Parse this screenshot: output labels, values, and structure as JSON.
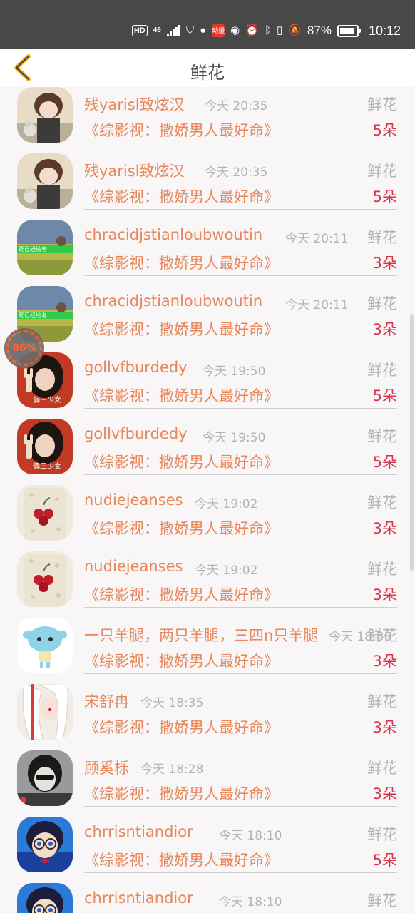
{
  "status_bar": {
    "hd": "HD",
    "network": "46",
    "app_badge": "动漫",
    "battery_percent": "87%",
    "battery_level": 0.87,
    "time": "10:12"
  },
  "header": {
    "title": "鲜花",
    "back_icon": "chevron-left-icon",
    "accent": "#f2b21e"
  },
  "floating_widget": {
    "label": "86%"
  },
  "rows": [
    {
      "name": "残yarisl致炫汉",
      "time": "今天 20:35",
      "gift": "鲜花",
      "book": "《综影视：撒娇男人最好命》",
      "count": "5朵",
      "avatar": "anime-boy-avatar"
    },
    {
      "name": "残yarisl致炫汉",
      "time": "今天 20:35",
      "gift": "鲜花",
      "book": "《综影视：撒娇男人最好命》",
      "count": "5朵",
      "avatar": "anime-boy-avatar"
    },
    {
      "name": "chracidjstianloubwoutin",
      "time": "今天 20:11",
      "gift": "鲜花",
      "book": "《综影视：撒娇男人最好命》",
      "count": "3朵",
      "avatar": "field-avatar"
    },
    {
      "name": "chracidjstianloubwoutin",
      "time": "今天 20:11",
      "gift": "鲜花",
      "book": "《综影视：撒娇男人最好命》",
      "count": "3朵",
      "avatar": "field-avatar"
    },
    {
      "name": "gollvfburdedy",
      "time": "今天 19:50",
      "gift": "鲜花",
      "book": "《综影视：撒娇男人最好命》",
      "count": "5朵",
      "avatar": "girl-peace-avatar"
    },
    {
      "name": "gollvfburdedy",
      "time": "今天 19:50",
      "gift": "鲜花",
      "book": "《综影视：撒娇男人最好命》",
      "count": "5朵",
      "avatar": "girl-peace-avatar"
    },
    {
      "name": "nudiejeanses",
      "time": "今天 19:02",
      "gift": "鲜花",
      "book": "《综影视：撒娇男人最好命》",
      "count": "3朵",
      "avatar": "cherry-phone-avatar"
    },
    {
      "name": "nudiejeanses",
      "time": "今天 19:02",
      "gift": "鲜花",
      "book": "《综影视：撒娇男人最好命》",
      "count": "3朵",
      "avatar": "cherry-phone-avatar"
    },
    {
      "name": "一只羊腿，两只羊腿，三四n只羊腿",
      "time": "今天 18:38",
      "gift": "鲜花",
      "book": "《综影视：撒娇男人最好命》",
      "count": "3朵",
      "avatar": "blue-creature-avatar"
    },
    {
      "name": "宋舒冉",
      "time": "今天 18:35",
      "gift": "鲜花",
      "book": "《综影视：撒娇男人最好命》",
      "count": "3朵",
      "avatar": "white-hair-avatar"
    },
    {
      "name": "顾奚栎",
      "time": "今天 18:28",
      "gift": "鲜花",
      "book": "《综影视：撒娇男人最好命》",
      "count": "3朵",
      "avatar": "girl-bw-avatar"
    },
    {
      "name": "chrrisntiandior",
      "time": "今天 18:10",
      "gift": "鲜花",
      "book": "《综影视：撒娇男人最好命》",
      "count": "5朵",
      "avatar": "conan-avatar"
    },
    {
      "name": "chrrisntiandior",
      "time": "今天 18:10",
      "gift": "鲜花",
      "book": "",
      "count": "",
      "avatar": "conan-avatar"
    }
  ]
}
